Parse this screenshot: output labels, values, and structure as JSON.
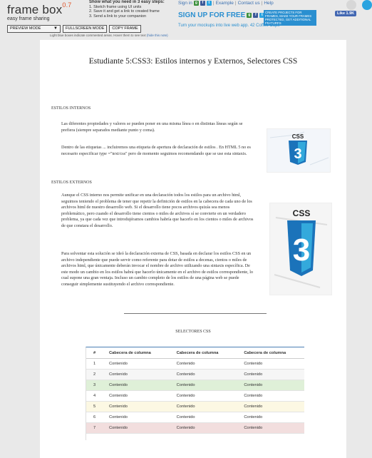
{
  "framebox": {
    "logo": "frame box",
    "version": "0.7",
    "tagline": "easy frame sharing",
    "preview_mode": "PREVIEW MODE",
    "fullscreen": "FULLSCREEN MODE",
    "copy_frame": "COPY FRAME",
    "hint": "Light blue boxes indicate commented areas. Hover them to see text",
    "hint_link": "(hide this note)",
    "steps_title": "Show what you need in 3 easy steps:",
    "step1": "1. Sketch frame using UI units",
    "step2": "2. Save it and get a link to created frame",
    "step3": "3. Send a link to your companion",
    "sign_in": "Sign in",
    "example": "Example",
    "contact": "Contact us",
    "help": "Help",
    "signup": "SIGN UP FOR FREE",
    "create_note": "CREATE PROJECTS FOR FRAMES, MAKE YOUR FRAMES PROTECTED, GET ADDITIONAL FEATURES",
    "mockups": "Turn your mockups into live web app. 42 Coffee Cups",
    "like": "Like 1.9K",
    "accent": "#2a8fd0"
  },
  "doc": {
    "title": "Estudiante 5:CSS3: Estilos internos y Externos, Selectores CSS",
    "sec1": "ESTILOS INTERNOS",
    "p1": "Las diferentes propiedades y valores se pueden poner en una misma línea o en distintas líneas según se prefiera (siempre separados mediante punto y coma).",
    "p2": "Dentro de las etiquetas ... incluiremos una etiqueta de apertura de declaración de estilos . En HTML 5 no es necesario especificar type =\"text/css\" pero de momento seguimos recomendando que se use esta sintaxis.",
    "sec2": "ESTILOS EXTERNOS",
    "p3": "Aunque el CSS interno nos permite unificar en una declaración todos los estilos para un archivo html, seguimos teniendo el problema de tener que repetir la definición de estilos en la cabecera de cada uno de los archivos html de nuestro desarrollo web. Si el desarrollo tiene pocos archivos quizás sea menos problemático, pero cuando el desarrollo tiene cientos o miles de archivos sí se convierte en un verdadero problema, ya que cada vez que introdujéramos cambios habría que hacerlo en los cientos o miles de archivos de que constara el desarrollo.",
    "p4": "Para solventar esta solución se ideó la declaración externa de CSS, basada en declarar los estilos CSS en un archivo independiente que puede servir como referente para dotar de estilos a decenas, cientos o miles de archivos html, que únicamente deberán invocar el nombre de archivo utilizando una sintaxis específica. De este modo un cambio en los estilos habrá que hacerlo únicamente en el archivo de estilos correspondiente, lo cual supone una gran ventaja. Incluso un cambio completo de los estilos de una página web se puede conseguir simplemente sustituyendo el archivo correspondiente.",
    "sec3": "SELECTORES CSS",
    "css_label": "CSS",
    "css_num": "3"
  },
  "table": {
    "headers": [
      "#",
      "Cabecera de columna",
      "Cabecera de columna",
      "Cabecera de columna"
    ],
    "rows": [
      {
        "n": "1",
        "c": [
          "Contenido",
          "Contenido",
          "Contenido"
        ],
        "color": "#ffffff"
      },
      {
        "n": "2",
        "c": [
          "Contenido",
          "Contenido",
          "Contenido"
        ],
        "color": "#f6f6f6"
      },
      {
        "n": "3",
        "c": [
          "Contenido",
          "Contenido",
          "Contenido"
        ],
        "color": "#dff0d8"
      },
      {
        "n": "4",
        "c": [
          "Contenido",
          "Contenido",
          "Contenido"
        ],
        "color": "#ffffff"
      },
      {
        "n": "5",
        "c": [
          "Contenido",
          "Contenido",
          "Contenido"
        ],
        "color": "#fcf8e3"
      },
      {
        "n": "6",
        "c": [
          "Contenido",
          "Contenido",
          "Contenido"
        ],
        "color": "#ffffff"
      },
      {
        "n": "7",
        "c": [
          "Contenido",
          "Contenido",
          "Contenido"
        ],
        "color": "#f2dede"
      }
    ]
  }
}
